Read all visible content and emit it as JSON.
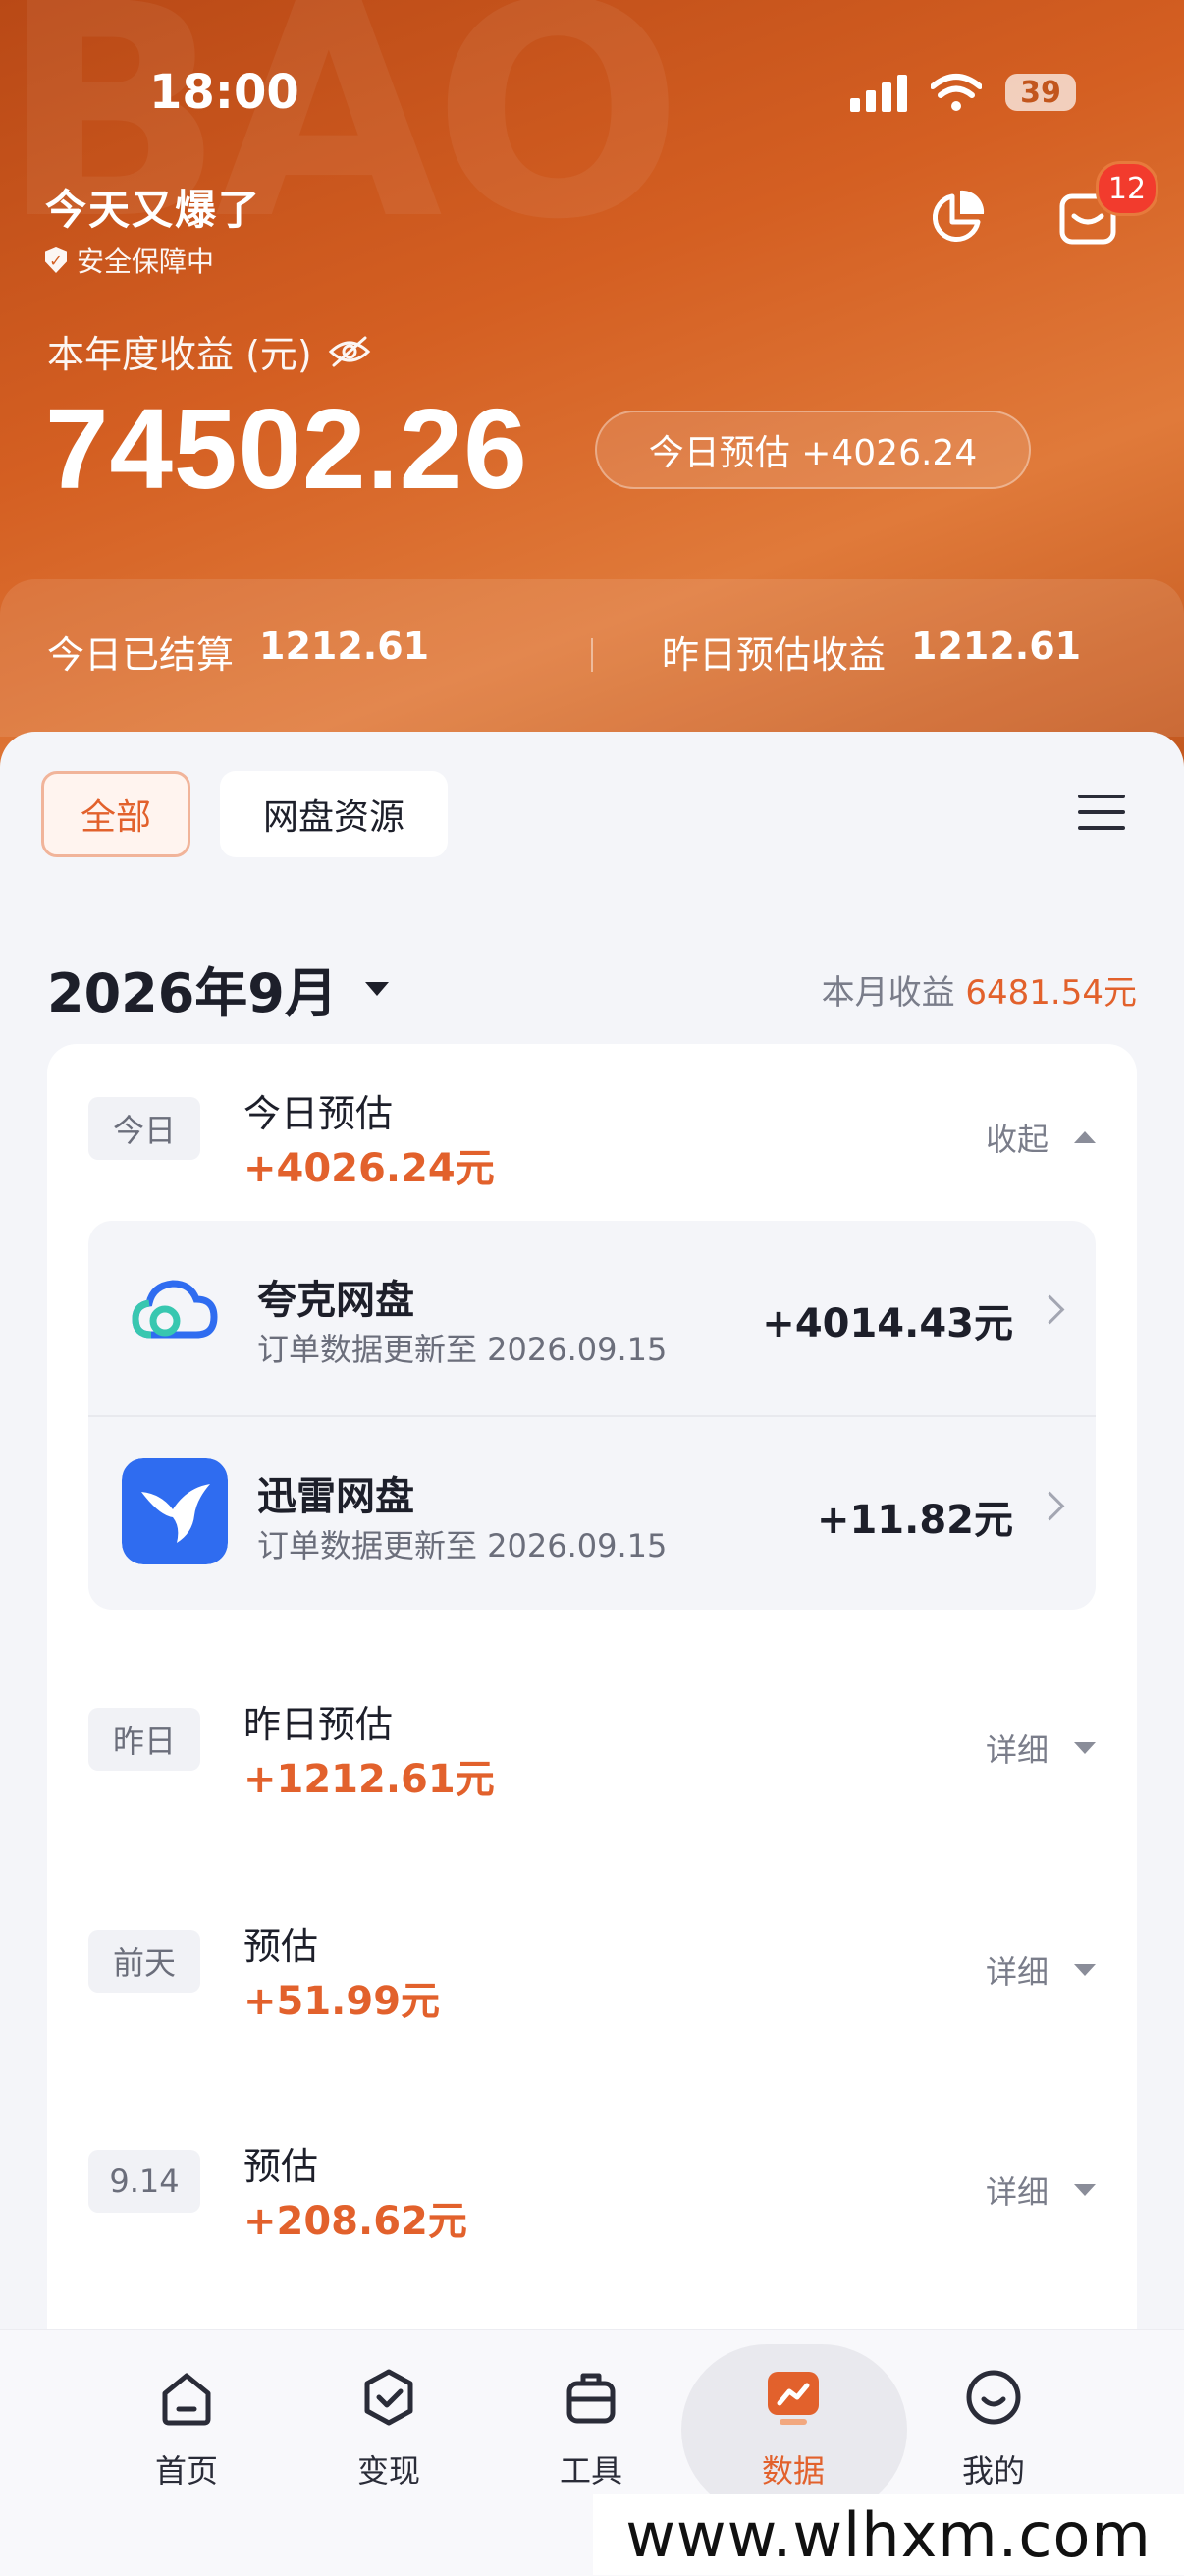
{
  "status_bar": {
    "time": "18:00",
    "battery": "39"
  },
  "header": {
    "app_title": "今天又爆了",
    "security_text": "安全保障中",
    "notification_count": "12",
    "year_income_label": "本年度收益 (元)",
    "year_income_value": "74502.26",
    "today_estimate": "今日预估 +4026.24"
  },
  "settlement": {
    "today_settled_label": "今日已结算",
    "today_settled_value": "1212.61",
    "yesterday_est_label": "昨日预估收益",
    "yesterday_est_value": "1212.61"
  },
  "filters": {
    "all": "全部",
    "netdisk": "网盘资源"
  },
  "month": {
    "label": "2026年9月",
    "income_label": "本月收益",
    "income_value": "6481.54元"
  },
  "days": [
    {
      "tag": "今日",
      "title": "今日预估",
      "amount": "+4026.24元",
      "action": "收起"
    },
    {
      "tag": "昨日",
      "title": "昨日预估",
      "amount": "+1212.61元",
      "action": "详细"
    },
    {
      "tag": "前天",
      "title": "预估",
      "amount": "+51.99元",
      "action": "详细"
    },
    {
      "tag": "9.14",
      "title": "预估",
      "amount": "+208.62元",
      "action": "详细"
    }
  ],
  "sub_items": [
    {
      "name": "夸克网盘",
      "desc": "订单数据更新至 2026.09.15",
      "amount": "+4014.43元"
    },
    {
      "name": "迅雷网盘",
      "desc": "订单数据更新至 2026.09.15",
      "amount": "+11.82元"
    }
  ],
  "tabs": [
    {
      "label": "首页"
    },
    {
      "label": "变现"
    },
    {
      "label": "工具"
    },
    {
      "label": "数据"
    },
    {
      "label": "我的"
    }
  ],
  "watermark": "www.wlhxm.com",
  "colors": {
    "accent": "#e2612c",
    "hero": "#d45f22"
  }
}
